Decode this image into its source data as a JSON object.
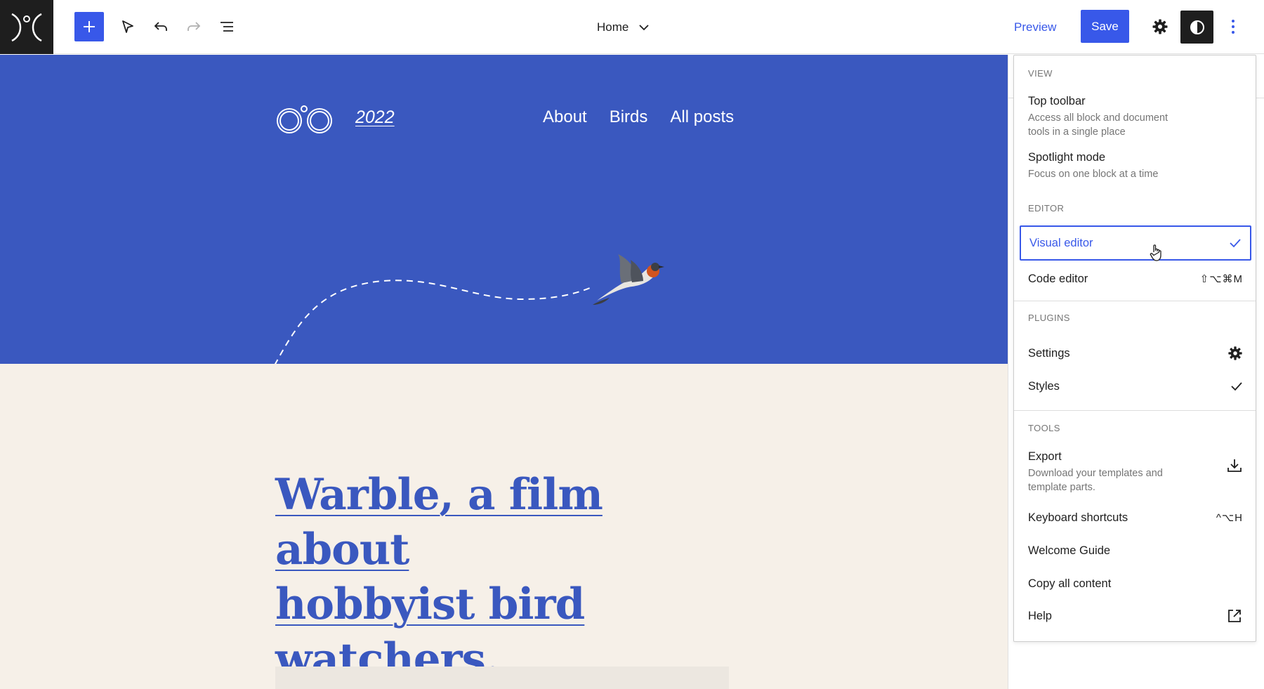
{
  "toolbar": {
    "document_title": "Home",
    "preview_label": "Preview",
    "save_label": "Save"
  },
  "hero": {
    "site_title": "2022",
    "nav": [
      "About",
      "Birds",
      "All posts"
    ]
  },
  "content": {
    "headline_lines": [
      "Warble, a film about",
      "hobbyist bird",
      "watchers."
    ]
  },
  "menu": {
    "view": {
      "label": "VIEW",
      "top_toolbar": {
        "title": "Top toolbar",
        "desc_line1": "Access all block and document",
        "desc_line2": "tools in a single place"
      },
      "spotlight": {
        "title": "Spotlight mode",
        "desc": "Focus on one block at a time"
      }
    },
    "editor": {
      "label": "EDITOR",
      "visual": {
        "title": "Visual editor",
        "checked": true
      },
      "code": {
        "title": "Code editor",
        "shortcut": "⇧⌥⌘M"
      }
    },
    "plugins": {
      "label": "PLUGINS",
      "settings": "Settings",
      "styles": {
        "title": "Styles",
        "checked": true
      }
    },
    "tools": {
      "label": "TOOLS",
      "export": {
        "title": "Export",
        "desc_line1": "Download your templates and",
        "desc_line2": "template parts."
      },
      "keyboard": {
        "title": "Keyboard shortcuts",
        "shortcut": "^⌥H"
      },
      "welcome": "Welcome Guide",
      "copy": "Copy all content",
      "help": "Help"
    }
  },
  "colors": {
    "accent": "#3858e9",
    "hero_bg": "#3a58bf",
    "content_bg": "#f6f0e8"
  }
}
